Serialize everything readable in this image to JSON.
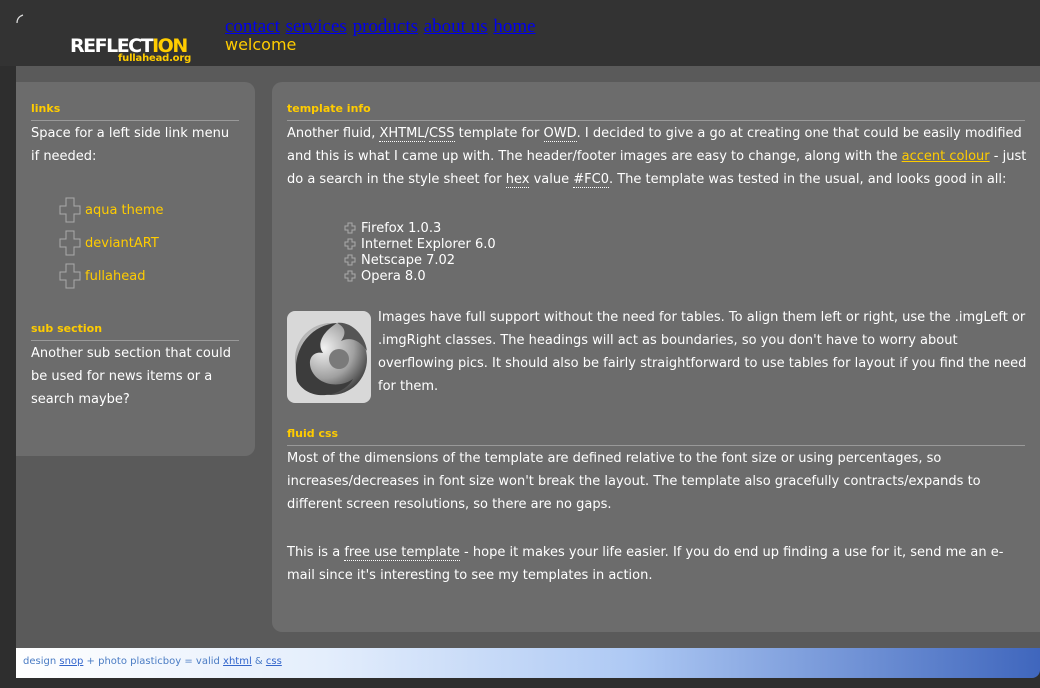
{
  "header": {
    "logo": {
      "main": "REFLECT",
      "accent": "ION",
      "sub": "fullahead.org"
    },
    "nav": [
      "contact",
      "services",
      "products",
      "about us",
      "home"
    ],
    "welcome": "welcome"
  },
  "sidebar": {
    "links_heading": "links",
    "links_text": "Space for a left side link menu if needed:",
    "links": [
      "aqua theme",
      "deviantART",
      "fullahead"
    ],
    "sub_heading": "sub section",
    "sub_text": "Another sub section that could be used for news items or a search maybe?"
  },
  "content": {
    "info_heading": "template info",
    "info_p1": "Another fluid, ",
    "xhtml": "XHTML",
    "slash": "/",
    "css": "CSS",
    "info_p2": " template for ",
    "owd": "OWD",
    "info_p3": ". I decided to give a go at creating one that could be easily modified and this is what I came up with. The header/footer images are easy to change, along with the ",
    "accent_link": "accent colour",
    "info_p4": " - just do a search in the style sheet for ",
    "hex": "hex",
    "info_p5": " value ",
    "fc0": "#FC0",
    "info_p6": ". The template was tested in the usual, and looks good in all:",
    "browsers": [
      "Firefox 1.0.3",
      "Internet Explorer 6.0",
      "Netscape 7.02",
      "Opera 8.0"
    ],
    "images_text": "Images have full support without the need for tables. To align them left or right, use the .imgLeft or .imgRight classes. The headings will act as boundaries, so you don't have to worry about overflowing pics. It should also be fairly straightforward to use tables for layout if you find the need for them.",
    "fluid_heading": "fluid css",
    "fluid_text": "Most of the dimensions of the template are defined relative to the font size or using percentages, so increases/decreases in font size won't break the layout. The template also gracefully contracts/expands to different screen resolutions, so there are no gaps.",
    "free_p1": "This is a ",
    "free_link": "free use template",
    "free_p2": " - hope it makes your life easier. If you do end up finding a use for it, send me an e-mail since it's interesting to see my templates in action."
  },
  "footer": {
    "t1": "design ",
    "snop": "snop",
    "t2": " + photo plasticboy = valid ",
    "xhtml": "xhtml",
    "t3": " & ",
    "css": "css"
  },
  "colors": {
    "accent": "#ffcc00",
    "panel": "#6c6c6c",
    "background": "#2e2e2e"
  }
}
